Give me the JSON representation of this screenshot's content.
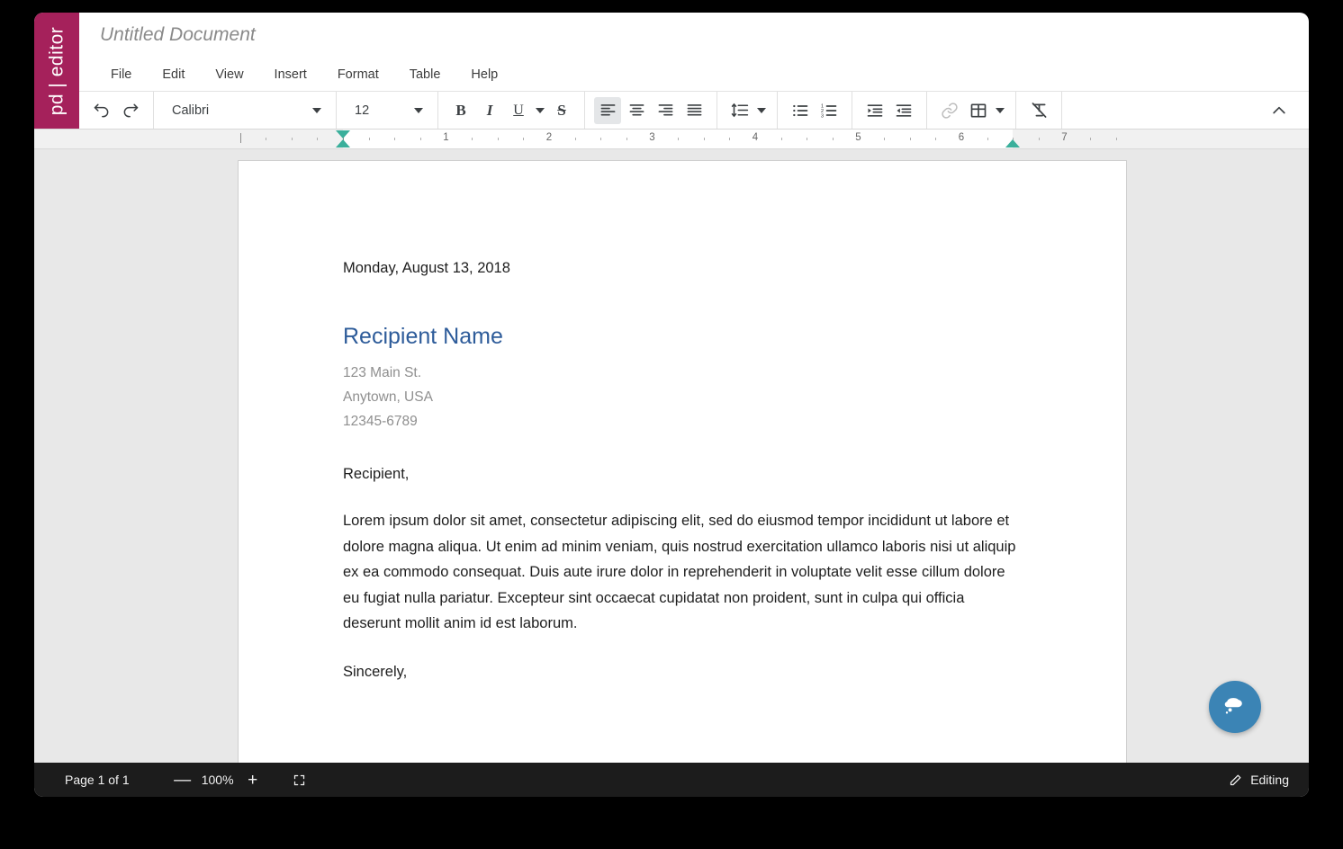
{
  "brand": {
    "logo_text": "pd | editor",
    "logo_color": "#A5215B"
  },
  "header": {
    "document_title": "Untitled Document"
  },
  "menu": {
    "items": [
      {
        "label": "File",
        "name": "menu-file"
      },
      {
        "label": "Edit",
        "name": "menu-edit"
      },
      {
        "label": "View",
        "name": "menu-view"
      },
      {
        "label": "Insert",
        "name": "menu-insert"
      },
      {
        "label": "Format",
        "name": "menu-format"
      },
      {
        "label": "Table",
        "name": "menu-table"
      },
      {
        "label": "Help",
        "name": "menu-help"
      }
    ]
  },
  "toolbar": {
    "undo_label": "Undo",
    "redo_label": "Redo",
    "font_family": "Calibri",
    "font_size": "12",
    "bold_label": "B",
    "italic_label": "I",
    "underline_label": "U",
    "strikethrough_label": "S",
    "align_active": "left",
    "collapse_label": "Collapse toolbar",
    "link_disabled": true
  },
  "ruler": {
    "numbers": [
      "1",
      "2",
      "3",
      "4",
      "5",
      "6",
      "7"
    ],
    "left_indent_position_in": 0.0,
    "right_indent_position_in": 6.5,
    "marker_color": "#3aaf9b",
    "unit": "inches"
  },
  "document": {
    "date": "Monday, August 13, 2018",
    "recipient_heading": "Recipient Name",
    "heading_color": "#2E5C9A",
    "address_lines": [
      "123 Main St.",
      "Anytown, USA",
      "12345-6789"
    ],
    "salutation": "Recipient,",
    "paragraph": "Lorem ipsum dolor sit amet, consectetur adipiscing elit, sed do eiusmod tempor incididunt ut labore et dolore magna aliqua. Ut enim ad minim veniam, quis nostrud exercitation ullamco laboris nisi ut aliquip ex ea commodo consequat. Duis aute irure dolor in reprehenderit in voluptate velit esse cillum dolore eu fugiat nulla pariatur. Excepteur sint occaecat cupidatat non proident, sunt in culpa qui officia deserunt mollit anim id est laborum.",
    "closing": "Sincerely,"
  },
  "chat": {
    "button_color": "#3b84b5",
    "icon": "chat-bubble-icon"
  },
  "status": {
    "page_indicator": "Page 1 of 1",
    "zoom_out_label": "—",
    "zoom_level": "100%",
    "zoom_in_label": "+",
    "fullscreen_label": "Fit to screen",
    "mode_label": "Editing"
  }
}
